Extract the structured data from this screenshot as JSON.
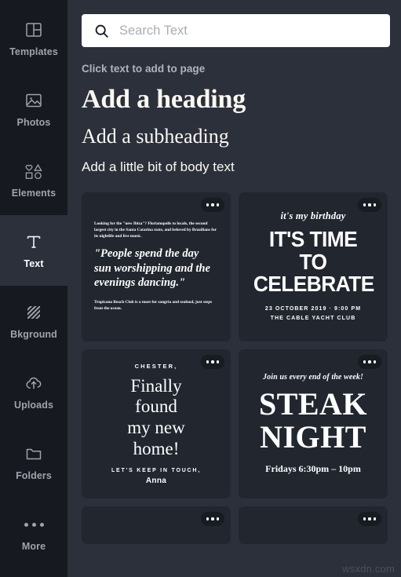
{
  "sidebar": {
    "items": [
      {
        "label": "Templates",
        "icon": "templates-icon",
        "active": false
      },
      {
        "label": "Photos",
        "icon": "photos-icon",
        "active": false
      },
      {
        "label": "Elements",
        "icon": "elements-icon",
        "active": false
      },
      {
        "label": "Text",
        "icon": "text-icon",
        "active": true
      },
      {
        "label": "Bkground",
        "icon": "background-icon",
        "active": false
      },
      {
        "label": "Uploads",
        "icon": "uploads-icon",
        "active": false
      },
      {
        "label": "Folders",
        "icon": "folders-icon",
        "active": false
      },
      {
        "label": "More",
        "icon": "more-dots-icon",
        "active": false
      }
    ]
  },
  "search": {
    "icon": "search-icon",
    "value": "",
    "placeholder": "Search Text"
  },
  "panel": {
    "hint": "Click text to add to page",
    "presets": {
      "heading": "Add a heading",
      "subheading": "Add a subheading",
      "body": "Add a little bit of body text"
    }
  },
  "templates": {
    "menu_icon": "more-dots-icon",
    "cards": [
      {
        "id": "travel-quote",
        "intro": "Looking for the \"new Ibiza\"? Florianopolis to locals, the second largest city in the Santa Catarina state, and beloved by Brazilians for its nightlife and live music.",
        "quote": "\"People spend the day sun worshipping and the evenings dancing.\"",
        "footnote": "Tropicana Beach Club is a must for sangria and seafood, just steps from the ocean."
      },
      {
        "id": "birthday-invite",
        "script": "it's my birthday",
        "line1": "IT'S TIME TO",
        "line2": "CELEBRATE",
        "meta1": "23 OCTOBER 2019  ·  9:00 PM",
        "meta2": "THE CABLE YACHT CLUB"
      },
      {
        "id": "new-home-card",
        "salutation": "CHESTER,",
        "line1": "Finally",
        "line2": "found",
        "line3": "my new",
        "line4": "home!",
        "signoff": "LET'S KEEP IN TOUCH,",
        "name": "Anna"
      },
      {
        "id": "steak-night",
        "top": "Join us every end of the week!",
        "line1": "STEAK",
        "line2": "NIGHT",
        "meta": "Fridays 6:30pm – 10pm"
      }
    ]
  },
  "watermark": {
    "text": "wsxdn.com"
  },
  "colors": {
    "sidebar_bg": "#16191f",
    "panel_bg": "#2b303b",
    "card_bg": "#21262f",
    "search_bg": "#ffffff",
    "text_muted": "#9ea3ad",
    "text_active": "#ffffff",
    "preset_text": "#fbf8f0"
  }
}
